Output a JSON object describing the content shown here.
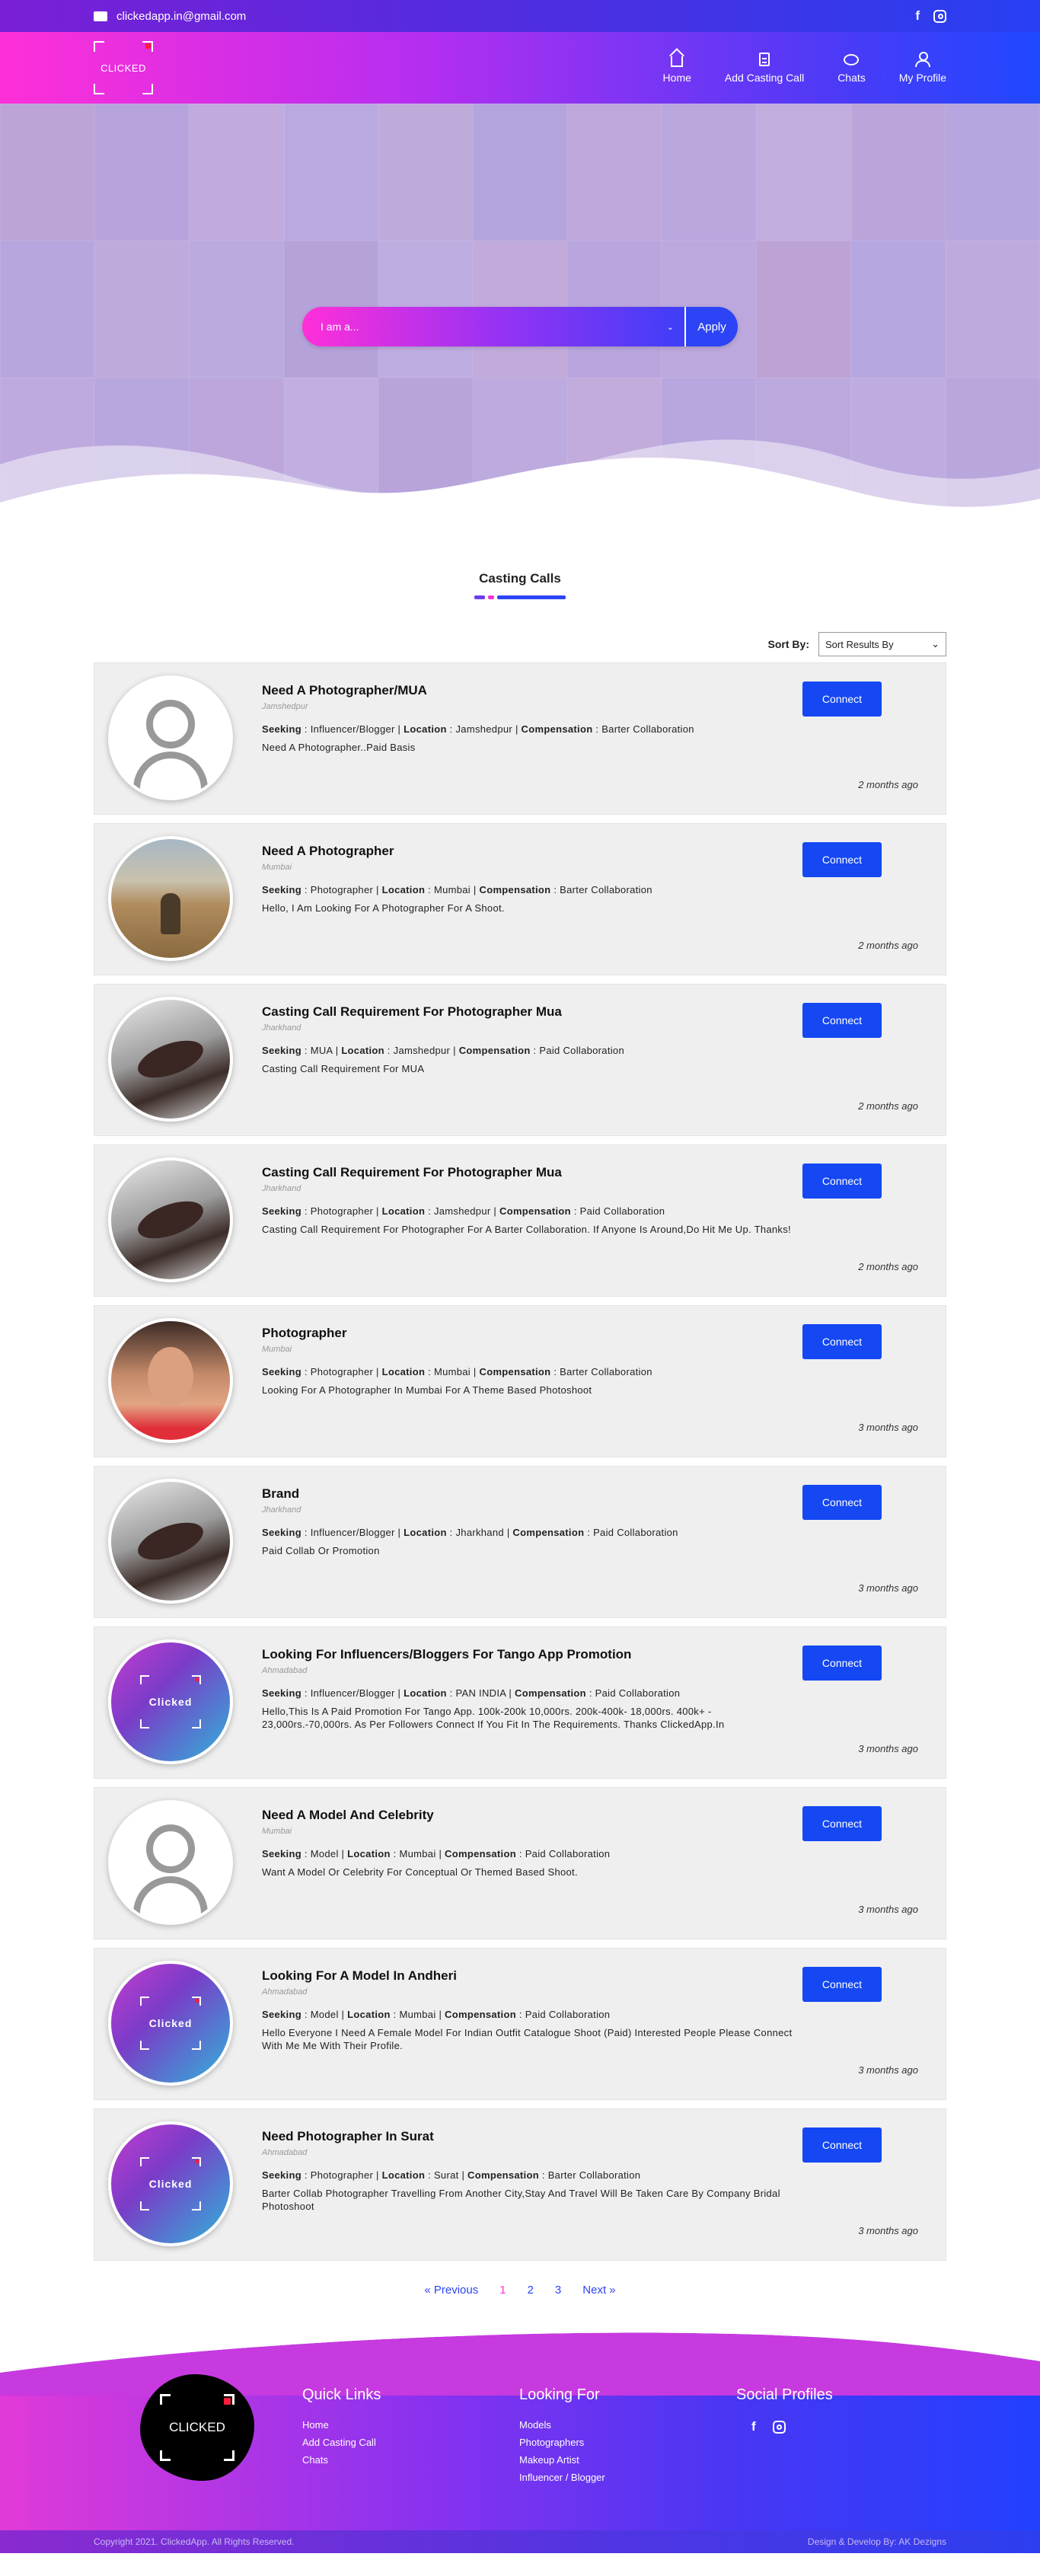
{
  "topbar": {
    "email": "clickedapp.in@gmail.com"
  },
  "header": {
    "logo_text": "CLICKED",
    "nav": [
      {
        "label": "Home",
        "icon": "home-icon"
      },
      {
        "label": "Add Casting Call",
        "icon": "document-icon"
      },
      {
        "label": "Chats",
        "icon": "chat-icon"
      },
      {
        "label": "My Profile",
        "icon": "user-icon"
      }
    ]
  },
  "hero": {
    "select_value": "I am a...",
    "apply_label": "Apply"
  },
  "section": {
    "title": "Casting Calls"
  },
  "sort": {
    "label": "Sort By:",
    "value": "Sort Results By"
  },
  "connect_label": "Connect",
  "meta_labels": {
    "seeking": "Seeking",
    "location": "Location",
    "compensation": "Compensation"
  },
  "cards": [
    {
      "title": "Need A Photographer/MUA",
      "place": "Jamshedpur",
      "seeking": "Influencer/Blogger",
      "location": "Jamshedpur",
      "compensation": "Barter Collaboration",
      "desc": "Need A Photographer..Paid Basis",
      "ago": "2 months ago",
      "avatar": "default"
    },
    {
      "title": "Need A Photographer",
      "place": "Mumbai",
      "seeking": "Photographer",
      "location": "Mumbai",
      "compensation": "Barter Collaboration",
      "desc": "Hello, I Am Looking For A Photographer For A Shoot.",
      "ago": "2 months ago",
      "avatar": "photo1"
    },
    {
      "title": "Casting Call Requirement For Photographer Mua",
      "place": "Jharkhand",
      "seeking": "MUA",
      "location": "Jamshedpur",
      "compensation": "Paid Collaboration",
      "desc": "Casting Call Requirement For MUA",
      "ago": "2 months ago",
      "avatar": "woman"
    },
    {
      "title": "Casting Call Requirement For Photographer Mua",
      "place": "Jharkhand",
      "seeking": "Photographer",
      "location": "Jamshedpur",
      "compensation": "Paid Collaboration",
      "desc": "Casting Call Requirement For Photographer For A Barter Collaboration. If Anyone Is Around,Do Hit Me Up. Thanks!",
      "ago": "2 months ago",
      "avatar": "woman"
    },
    {
      "title": "Photographer",
      "place": "Mumbai",
      "seeking": "Photographer",
      "location": "Mumbai",
      "compensation": "Barter Collaboration",
      "desc": "Looking For A Photographer In Mumbai For A Theme Based Photoshoot",
      "ago": "3 months ago",
      "avatar": "face"
    },
    {
      "title": "Brand",
      "place": "Jharkhand",
      "seeking": "Influencer/Blogger",
      "location": "Jharkhand",
      "compensation": "Paid Collaboration",
      "desc": "Paid Collab Or Promotion",
      "ago": "3 months ago",
      "avatar": "woman"
    },
    {
      "title": "Looking For Influencers/Bloggers For Tango App Promotion",
      "place": "Ahmadabad",
      "seeking": "Influencer/Blogger",
      "location": "PAN INDIA",
      "compensation": "Paid Collaboration",
      "desc": "Hello,This Is A Paid Promotion For Tango App. 100k-200k 10,000rs. 200k-400k- 18,000rs. 400k+ - 23,000rs.-70,000rs. As Per Followers Connect If You Fit In The Requirements. Thanks ClickedApp.In",
      "ago": "3 months ago",
      "avatar": "clicked"
    },
    {
      "title": "Need A Model And Celebrity",
      "place": "Mumbai",
      "seeking": "Model",
      "location": "Mumbai",
      "compensation": "Paid Collaboration",
      "desc": "Want A Model Or Celebrity For Conceptual Or Themed Based Shoot.",
      "ago": "3 months ago",
      "avatar": "default"
    },
    {
      "title": "Looking For A Model In Andheri",
      "place": "Ahmadabad",
      "seeking": "Model",
      "location": "Mumbai",
      "compensation": "Paid Collaboration",
      "desc": "Hello Everyone I Need A Female Model For Indian Outfit Catalogue Shoot (Paid) Interested People Please Connect With Me Me With Their Profile.",
      "ago": "3 months ago",
      "avatar": "clicked"
    },
    {
      "title": "Need Photographer In Surat",
      "place": "Ahmadabad",
      "seeking": "Photographer",
      "location": "Surat",
      "compensation": "Barter Collaboration",
      "desc": "Barter Collab Photographer Travelling From Another City,Stay And Travel Will Be Taken Care By Company Bridal Photoshoot",
      "ago": "3 months ago",
      "avatar": "clicked"
    }
  ],
  "avatar_text": "Clicked",
  "pagination": {
    "prev": "« Previous",
    "pages": [
      "1",
      "2",
      "3"
    ],
    "active": "1",
    "next": "Next »"
  },
  "footer": {
    "logo_text": "CLICKED",
    "quick_links": {
      "title": "Quick Links",
      "items": [
        "Home",
        "Add Casting Call",
        "Chats"
      ]
    },
    "looking_for": {
      "title": "Looking For",
      "items": [
        "Models",
        "Photographers",
        "Makeup Artist",
        "Influencer / Blogger"
      ]
    },
    "social": {
      "title": "Social Profiles"
    },
    "copyright": "Copyright 2021. ClickedApp. All Rights Reserved.",
    "credit": "Design & Develop By: AK Dezigns"
  },
  "colors": {
    "accent": "#2c44f5",
    "pink": "#ff2fd8",
    "connect": "#1548f2"
  }
}
